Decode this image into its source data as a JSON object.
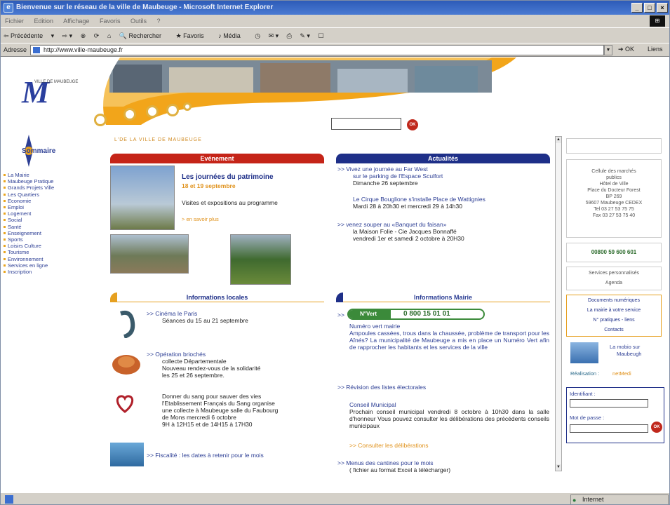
{
  "window": {
    "title": "Bienvenue sur le réseau de la ville de Maubeuge - Microsoft Internet Explorer",
    "min": "_",
    "max": "□",
    "close": "×"
  },
  "menu": [
    "Fichier",
    "Edition",
    "Affichage",
    "Favoris",
    "Outils",
    "?"
  ],
  "toolbar": {
    "back": "Précédente",
    "search": "Rechercher",
    "favorites": "Favoris",
    "media": "Média"
  },
  "address": {
    "label": "Adresse",
    "url": "http://www.ville-maubeuge.fr",
    "go": "OK",
    "links": "Liens"
  },
  "site": {
    "logo": "M",
    "logo_sub": "VILLE DE MAUBEUGE",
    "breadcrumb": "L'DE LA VILLE DE MAUBEUGE",
    "search_ok": "OK",
    "sommaire": "Sommaire",
    "menu": [
      "La Mairie",
      "Maubeuge Pratique",
      "Grands Projets Ville",
      "Les Quartiers",
      "Economie",
      "Emploi",
      "Logement",
      "Social",
      "Santé",
      "Enseignement",
      "Sports",
      "Loisirs Culture",
      "Tourisme",
      "Environnement",
      "Services en ligne",
      "Inscription"
    ]
  },
  "evenement": {
    "head": "Evénement",
    "title": "Les journées du patrimoine",
    "dates": "18 et 19 septembre",
    "desc": "Visites et expositions au programme",
    "more": "> en savoir plus"
  },
  "actualites": {
    "head": "Actualités",
    "items": [
      {
        "l1": ">> Vivez une journée au Far West",
        "l2": "sur le parking de l'Espace Sculfort",
        "l3": "Dimanche 26 septembre"
      },
      {
        "l1": "Le Cirque Bouglione s'installe Place de Wattignies",
        "l2": "Mardi 28 à 20h30 et mercredi 29 à 14h30",
        "l3": ""
      },
      {
        "l1": ">> venez souper au «Banquet du faisan»",
        "l2": "la Maison Folie - Cie Jacques Bonnaffé",
        "l3": "vendredi 1er et samedi 2 octobre à 20H30"
      }
    ]
  },
  "infos_locales": {
    "head": "Informations locales",
    "items": [
      {
        "l1": ">> Cinéma le Paris",
        "l2": "Séances du 15 au 21 septembre"
      },
      {
        "l1": ">> Opération briochés",
        "l2": "collecte Départementale",
        "l3": "Nouveau rendez-vous de la solidarité",
        "l4": "les 25 et 26 septembre."
      },
      {
        "l1": "Donner du sang pour sauver des vies",
        "l2": "l'Etablissement Français du Sang organise",
        "l3": "une collecte à Maubeuge salle du Faubourg",
        "l4": "de Mons mercredi 6 octobre",
        "l5": "9H à 12H15 et de 14H15 à 17H30"
      },
      {
        "l1": ">> Fiscalité : les dates à retenir pour le mois"
      }
    ]
  },
  "infos_mairie": {
    "head": "Informations Mairie",
    "numero": "0 800 15 01 01",
    "badge": "N°Vert",
    "nv_title": "Numéro vert mairie",
    "nv_text": "Ampoules cassées, trous dans la chaussée, problème de transport pour les Aînés? La municipalité de Maubeuge a mis en place un Numéro Vert afin de rapprocher les habitants et les services de la ville",
    "rev": ">> Révision des listes électorales",
    "cm_title": "Conseil Municipal",
    "cm_text": "Prochain conseil municipal vendredi 8 octobre à 10h30 dans la salle d'honneur Vous pouvez consulter les délibérations des précédents conseils municipaux",
    "cm_link": ">> Consulter les délibérations",
    "menus": ">> Menus des cantines pour le mois",
    "menus2": "( fichier au format Excel à télécharger)"
  },
  "right": {
    "cellule": [
      "Cellule des marchés",
      "publics",
      "Hôtel de Ville",
      "Place du Docteur Forest",
      "BP 269",
      "59607 Maubeuge CEDEX",
      "Tel 03 27 53 75 75",
      "Fax 03 27 53 75 40"
    ],
    "phone": "00800 59 600 601",
    "services": "Services personnalisés",
    "agenda": "Agenda",
    "docs": "Documents numériques",
    "mairie": "La mairie à votre service",
    "pratiques": "N° pratiques - liens",
    "contacts": "Contacts",
    "mobio": "La mobio sur",
    "mobio2": "Maubeugh",
    "realisation": "Réalisation :",
    "realisation_by": "netMedi",
    "login": "Identifiant :",
    "password": "Mot de passe :"
  },
  "status": {
    "left": "",
    "zone": "Internet"
  }
}
